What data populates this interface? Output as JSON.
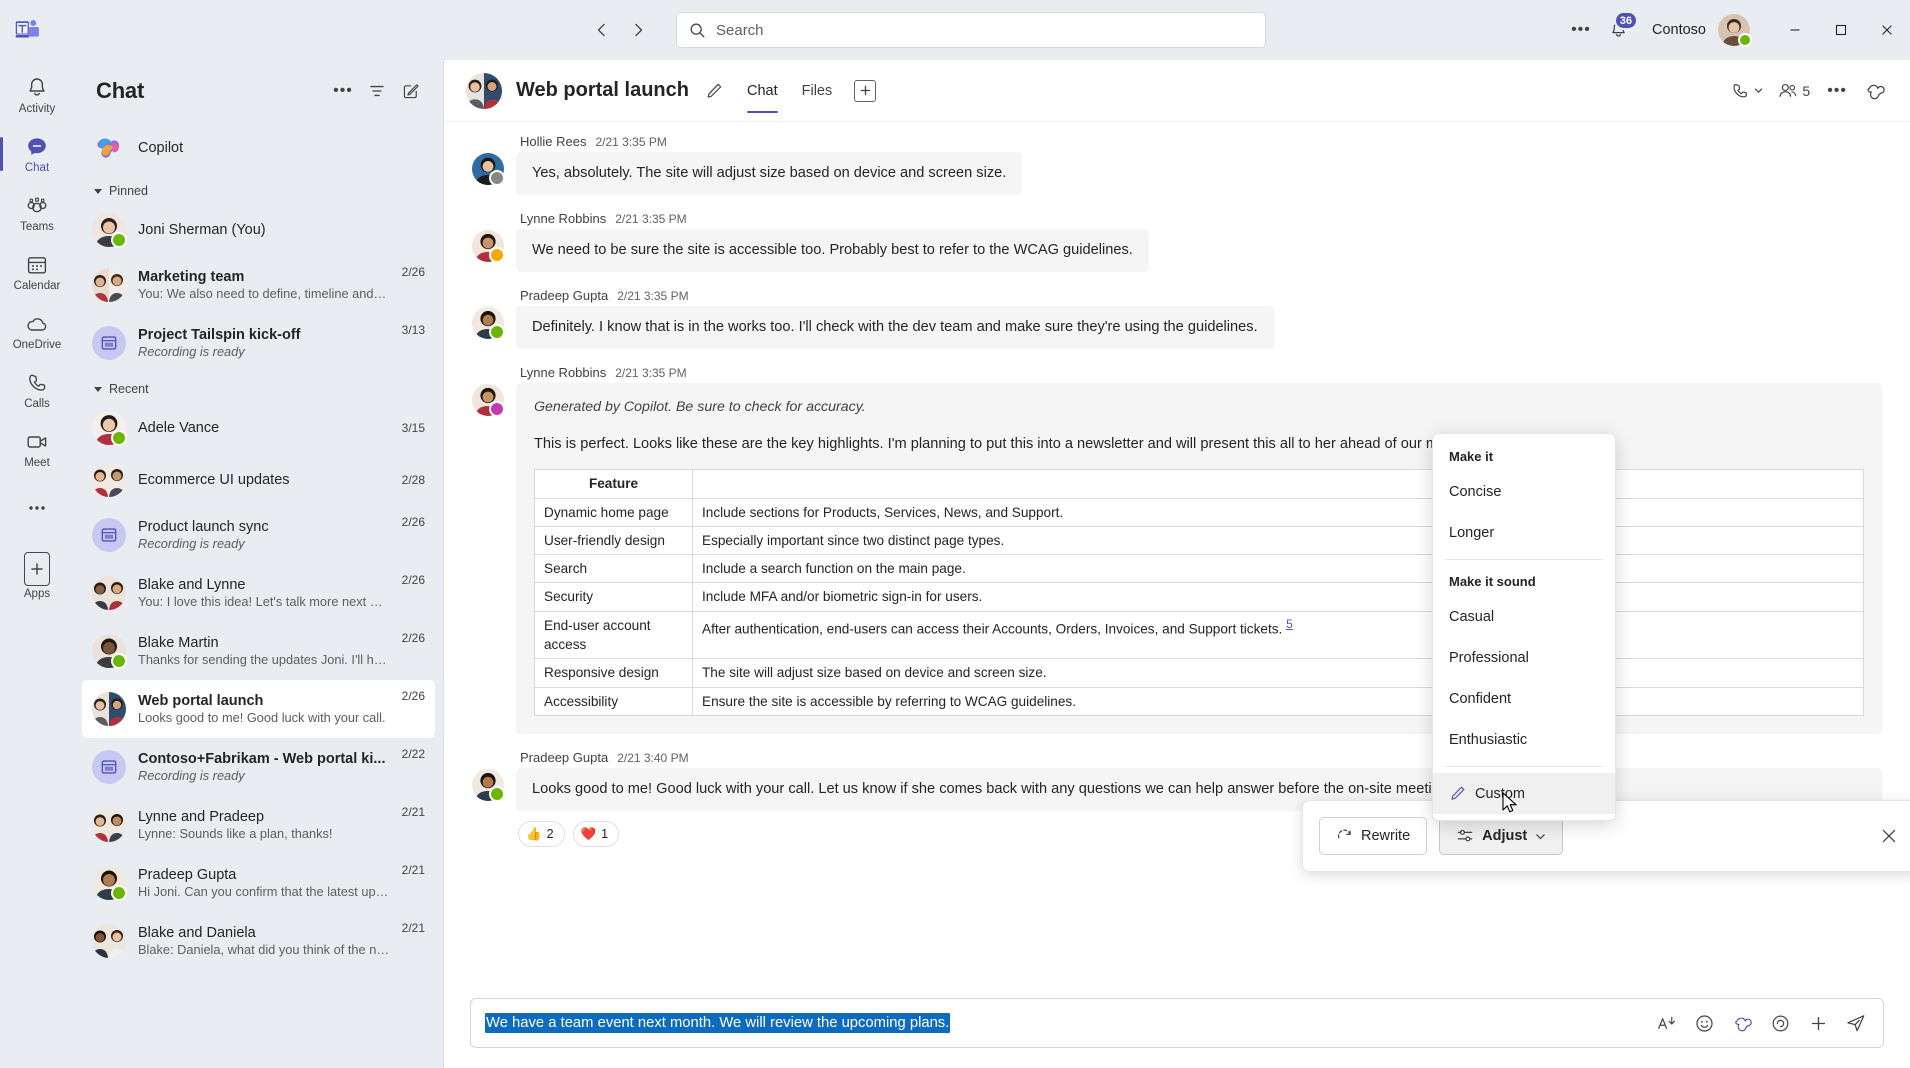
{
  "titlebar": {
    "app_logo": "teams-logo",
    "back_label": "‹",
    "forward_label": "›",
    "search_placeholder": "Search",
    "search_value": "",
    "more_label": "•••",
    "notification_badge": "36",
    "tenant": "Contoso",
    "minimize": "─",
    "maximize": "☐",
    "close": "✕"
  },
  "rail": {
    "items": [
      {
        "label": "Activity",
        "icon": "bell-icon",
        "active": false
      },
      {
        "label": "Chat",
        "icon": "chat-icon",
        "active": true
      },
      {
        "label": "Teams",
        "icon": "teams-icon",
        "active": false
      },
      {
        "label": "Calendar",
        "icon": "calendar-icon",
        "active": false
      },
      {
        "label": "OneDrive",
        "icon": "cloud-icon",
        "active": false
      },
      {
        "label": "Calls",
        "icon": "phone-icon",
        "active": false
      },
      {
        "label": "Meet",
        "icon": "video-icon",
        "active": false
      },
      {
        "label": "",
        "icon": "more-icon",
        "active": false
      },
      {
        "label": "Apps",
        "icon": "apps-icon",
        "active": false
      }
    ]
  },
  "chatlist": {
    "title": "Chat",
    "actions": [
      {
        "name": "more-options",
        "glyph": "•••"
      },
      {
        "name": "filter",
        "glyph": "filter-icon"
      },
      {
        "name": "new-chat",
        "glyph": "compose-icon"
      }
    ],
    "copilot": {
      "name": "Copilot"
    },
    "groups": [
      {
        "label": "Pinned"
      },
      {
        "label": "Recent"
      }
    ],
    "pinned": [
      {
        "name": "Joni Sherman (You)",
        "preview": "",
        "date": "",
        "avatar": "person",
        "presence": "avail",
        "bold": false
      },
      {
        "name": "Marketing team",
        "preview": "You: We also need to define, timeline and miles...",
        "date": "2/26",
        "avatar": "group",
        "presence": "",
        "bold": true
      },
      {
        "name": "Project Tailspin kick-off",
        "preview": "Recording is ready",
        "date": "3/13",
        "avatar": "meeting",
        "presence": "",
        "bold": true,
        "italic": true
      }
    ],
    "recent": [
      {
        "name": "Adele Vance",
        "preview": "",
        "date": "3/15",
        "avatar": "person",
        "presence": "avail",
        "bold": false
      },
      {
        "name": "Ecommerce UI updates",
        "preview": "",
        "date": "2/28",
        "avatar": "group",
        "presence": "",
        "bold": false
      },
      {
        "name": "Product launch sync",
        "preview": "Recording is ready",
        "date": "2/26",
        "avatar": "meeting",
        "presence": "",
        "bold": false,
        "italic": true
      },
      {
        "name": "Blake and Lynne",
        "preview": "You: I love this idea! Let's talk more next week.",
        "date": "2/26",
        "avatar": "group",
        "presence": "",
        "bold": false
      },
      {
        "name": "Blake Martin",
        "preview": "Thanks for sending the updates Joni. I'll have s...",
        "date": "2/26",
        "avatar": "person",
        "presence": "avail",
        "bold": false
      },
      {
        "name": "Web portal launch",
        "preview": "Looks good to me! Good luck with your call.",
        "date": "2/26",
        "avatar": "group",
        "presence": "",
        "bold": true,
        "selected": true
      },
      {
        "name": "Contoso+Fabrikam - Web portal ki...",
        "preview": "Recording is ready",
        "date": "2/22",
        "avatar": "meeting",
        "presence": "",
        "bold": true,
        "italic": true
      },
      {
        "name": "Lynne and Pradeep",
        "preview": "Lynne: Sounds like a plan, thanks!",
        "date": "2/21",
        "avatar": "group",
        "presence": "",
        "bold": false
      },
      {
        "name": "Pradeep Gupta",
        "preview": "Hi Joni. Can you confirm that the latest updates...",
        "date": "2/21",
        "avatar": "person",
        "presence": "avail",
        "bold": false
      },
      {
        "name": "Blake and Daniela",
        "preview": "Blake: Daniela, what did you think of the new d...",
        "date": "2/21",
        "avatar": "group",
        "presence": "",
        "bold": false
      }
    ]
  },
  "chat_header": {
    "title": "Web portal launch",
    "edit_icon": "pencil-icon",
    "tabs": [
      {
        "label": "Chat",
        "active": true
      },
      {
        "label": "Files",
        "active": false
      }
    ],
    "add_tab": "+",
    "call_icon": "call-icon",
    "participants_count": "5",
    "more_icon": "•••",
    "copilot_icon": "copilot-icon"
  },
  "messages": [
    {
      "author": "Hollie Rees",
      "time": "2/21 3:35 PM",
      "presence": "offl",
      "avatar": "hollie",
      "text": "Yes, absolutely. The site will adjust size based on device and screen size."
    },
    {
      "author": "Lynne Robbins",
      "time": "2/21 3:35 PM",
      "presence": "away",
      "avatar": "lynne",
      "text": "We need to be sure the site is accessible too. Probably best to refer to the WCAG guidelines."
    },
    {
      "author": "Pradeep Gupta",
      "time": "2/21 3:35 PM",
      "presence": "avail",
      "avatar": "pradeep",
      "text": "Definitely. I know that is in the works too. I'll check with the dev team and make sure they're using the guidelines."
    }
  ],
  "copilot_message": {
    "author": "Lynne Robbins",
    "time": "2/21 3:35 PM",
    "presence": "oof",
    "avatar": "lynne",
    "disclaimer": "Generated by Copilot. Be sure to check for accuracy.",
    "paragraph": "This is perfect. Looks like these are the key highlights. I'm planning to put this into a newsletter and will present this all to her ahead of our meeting next week.",
    "table": {
      "headers": [
        "Feature",
        ""
      ],
      "rows": [
        [
          "Dynamic home page",
          "Include sections for Products, Services, News, and Support."
        ],
        [
          "User-friendly design",
          "Especially important since two distinct page types."
        ],
        [
          "Search",
          "Include a search function on the main page."
        ],
        [
          "Security",
          "Include MFA and/or biometric sign-in for users."
        ],
        [
          "End-user account access",
          "After authentication, end-users can access their Accounts, Orders, Invoices, and Support tickets."
        ],
        [
          "Responsive design",
          "The site will adjust size based on device and screen size."
        ],
        [
          "Accessibility",
          "Ensure the site is accessible by referring to WCAG guidelines."
        ]
      ],
      "citation": "5"
    }
  },
  "last_message": {
    "author": "Pradeep Gupta",
    "time": "2/21 3:40 PM",
    "presence": "avail",
    "avatar": "pradeep",
    "text": "Looks good to me! Good luck with your call. Let us know if she comes back with any questions we can help answer before the on-site meeting.",
    "reactions": [
      {
        "emoji": "👍",
        "count": "2"
      },
      {
        "emoji": "❤️",
        "count": "1"
      }
    ]
  },
  "rewrite_bar": {
    "rewrite_label": "Rewrite",
    "rewrite_icon": "refresh-icon",
    "adjust_label": "Adjust",
    "adjust_icon": "sliders-icon",
    "adjust_chevron": "▾",
    "close_icon": "close-icon"
  },
  "adjust_menu": {
    "section1_title": "Make it",
    "section1_items": [
      {
        "label": "Concise"
      },
      {
        "label": "Longer"
      }
    ],
    "section2_title": "Make it sound",
    "section2_items": [
      {
        "label": "Casual"
      },
      {
        "label": "Professional"
      },
      {
        "label": "Confident"
      },
      {
        "label": "Enthusiastic"
      }
    ],
    "custom_item": {
      "label": "Custom",
      "icon": "pencil-edit-icon",
      "hovered": true
    }
  },
  "composer": {
    "selected_text": "We have a team event next month. We will review the upcoming plans.",
    "icons": [
      {
        "name": "format-icon",
        "glyph": "format"
      },
      {
        "name": "emoji-icon",
        "glyph": "emoji"
      },
      {
        "name": "copilot-icon",
        "glyph": "copilot"
      },
      {
        "name": "loop-icon",
        "glyph": "loop"
      },
      {
        "name": "plus-icon",
        "glyph": "plus"
      },
      {
        "name": "send-icon",
        "glyph": "send"
      }
    ]
  },
  "colors": {
    "accent": "#4f52b2",
    "selection": "#0f6cbd",
    "app_bg": "#e9edf2",
    "pane_bg": "#ffffff",
    "bubble_bg": "#f5f5f5"
  }
}
